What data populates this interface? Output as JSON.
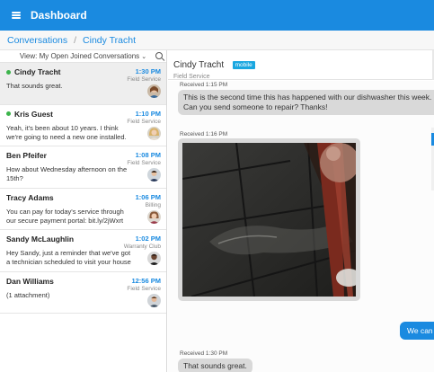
{
  "header": {
    "title": "Dashboard"
  },
  "breadcrumb": {
    "items": [
      "Conversations",
      "Cindy Tracht"
    ],
    "separator": "/"
  },
  "sidebar": {
    "view_label": "View: My Open Joined Conversations",
    "view_chevron": "⌄",
    "conversations": [
      {
        "name": "Cindy Tracht",
        "online": true,
        "time": "1:30 PM",
        "team": "Field Service",
        "preview": "That sounds great.",
        "active": true
      },
      {
        "name": "Kris Guest",
        "online": true,
        "time": "1:10 PM",
        "team": "Field Service",
        "preview": "Yeah, it's been about 10 years. I think we're going to need a new one installed."
      },
      {
        "name": "Ben Pfeifer",
        "online": false,
        "time": "1:08 PM",
        "team": "Field Service",
        "preview": "How about Wednesday afternoon on the 15th?"
      },
      {
        "name": "Tracy Adams",
        "online": false,
        "time": "1:06 PM",
        "team": "Billing",
        "preview": "You can pay for today's service through our secure payment portal: bit.ly/2jWxrt"
      },
      {
        "name": "Sandy McLaughlin",
        "online": false,
        "time": "1:02 PM",
        "team": "Warranty Club",
        "preview": "Hey Sandy, just a reminder that we've got a technician scheduled to visit your house"
      },
      {
        "name": "Dan Williams",
        "online": false,
        "time": "12:56 PM",
        "team": "Field Service",
        "preview": "(1 attachment)"
      }
    ]
  },
  "conversation": {
    "contact_name": "Cindy Tracht",
    "contact_badge": "mobile",
    "contact_team": "Field Service",
    "messages": [
      {
        "meta": "Received 1:15 PM",
        "text": "This is the second time this has happened with our dishwasher this week. Can you send someone to repair? Thanks!"
      },
      {
        "meta": "Received 1:16 PM",
        "attachment": "photo"
      },
      {
        "outgoing_text": "We can"
      },
      {
        "meta": "Received 1:30 PM",
        "text": "That sounds great."
      }
    ]
  },
  "colors": {
    "primary": "#1a8ae0",
    "online": "#3cb44b",
    "badge": "#1aa7e0",
    "bubble_in": "#d9d9d9"
  },
  "icons": {
    "menu": "hamburger-icon",
    "search": "search-icon",
    "chevron": "chevron-down-icon"
  }
}
